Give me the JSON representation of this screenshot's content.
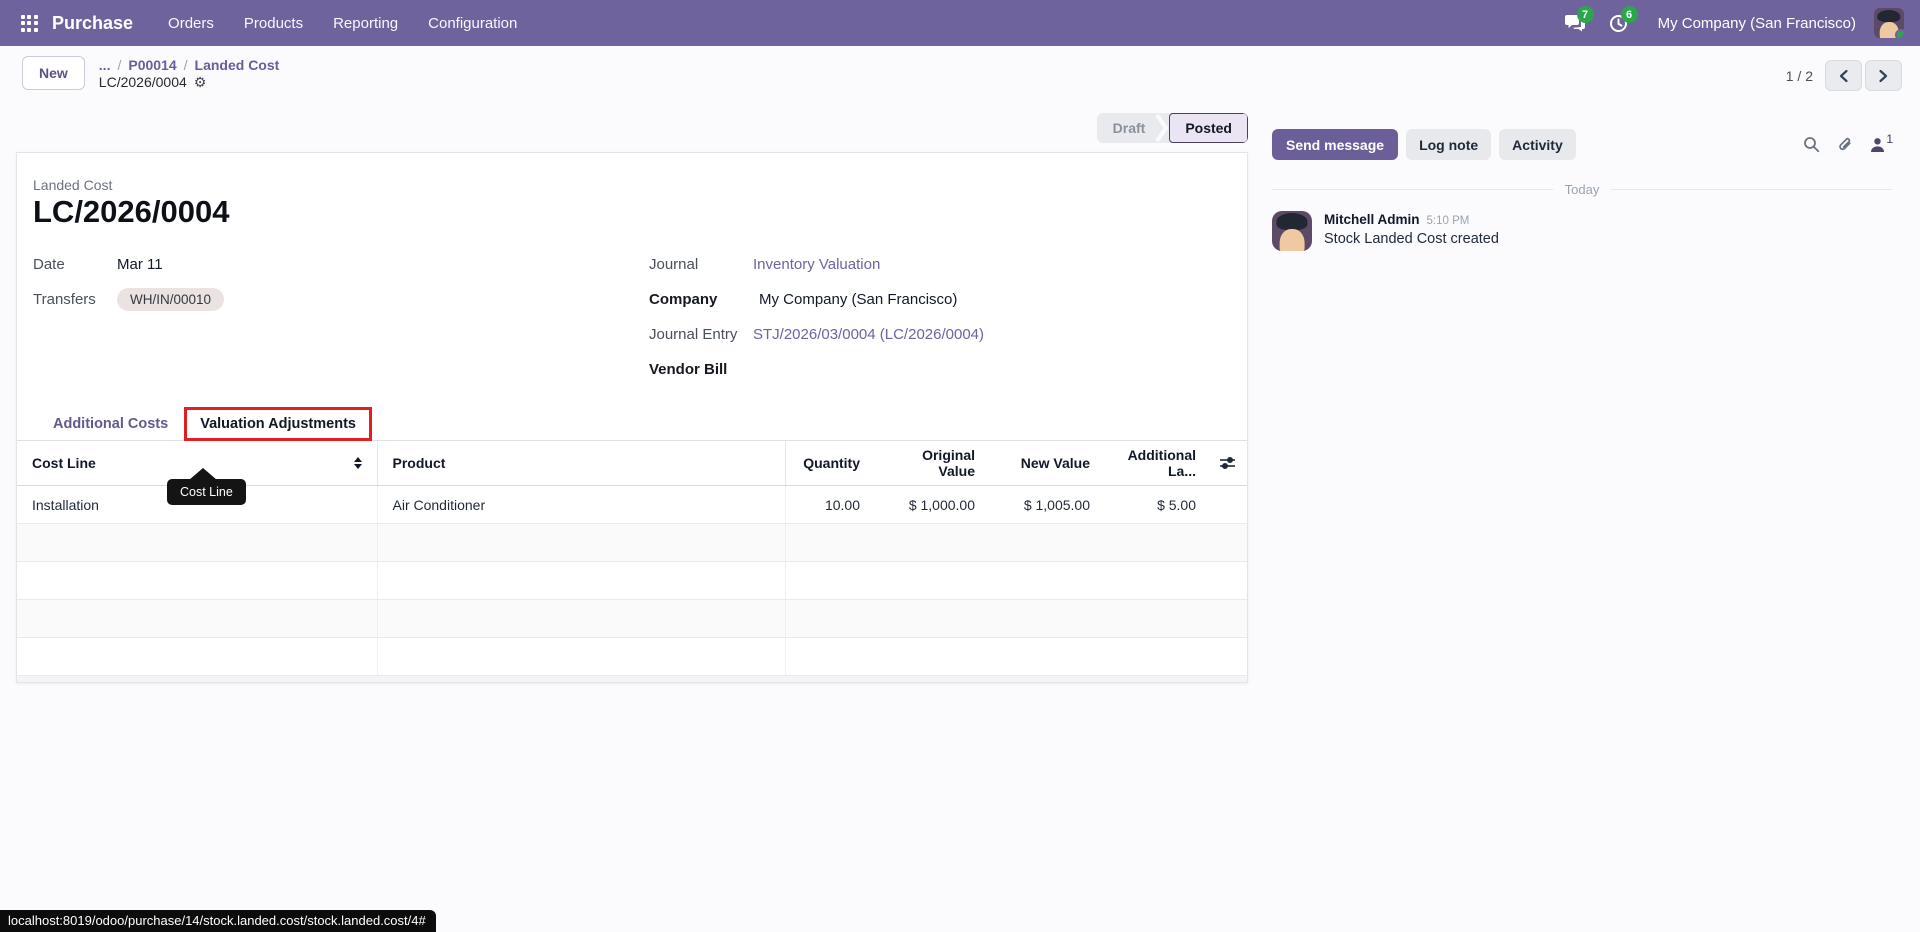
{
  "navbar": {
    "app_name": "Purchase",
    "menus": [
      "Orders",
      "Products",
      "Reporting",
      "Configuration"
    ],
    "messages_badge": "7",
    "activities_badge": "6",
    "company": "My Company (San Francisco)"
  },
  "control_panel": {
    "new_button": "New",
    "breadcrumb": {
      "ellipsis": "...",
      "separator": "/",
      "parent1": "P00014",
      "parent2": "Landed Cost",
      "current": "LC/2026/0004"
    },
    "pager": {
      "value": "1 / 2"
    }
  },
  "statusbar": {
    "draft": "Draft",
    "posted": "Posted"
  },
  "form": {
    "model_label": "Landed Cost",
    "title": "LC/2026/0004",
    "fields_left": [
      {
        "label": "Date",
        "value": "Mar 11"
      },
      {
        "label": "Transfers",
        "value": "WH/IN/00010"
      }
    ],
    "fields_right": [
      {
        "label": "Journal",
        "value": "Inventory Valuation"
      },
      {
        "label": "Company",
        "value": "My Company (San Francisco)"
      },
      {
        "label": "Journal Entry",
        "value": "STJ/2026/03/0004 (LC/2026/0004)"
      },
      {
        "label": "Vendor Bill",
        "value": ""
      }
    ],
    "tabs": [
      {
        "label": "Additional Costs"
      },
      {
        "label": "Valuation Adjustments"
      }
    ],
    "table": {
      "columns": [
        "Cost Line",
        "Product",
        "Quantity",
        "Original Value",
        "New Value",
        "Additional La..."
      ],
      "rows": [
        {
          "cost_line": "Installation",
          "product": "Air Conditioner",
          "quantity": "10.00",
          "original_value": "$ 1,000.00",
          "new_value": "$ 1,005.00",
          "additional": "$ 5.00"
        }
      ],
      "tooltip": "Cost Line"
    }
  },
  "chatter": {
    "send_message": "Send message",
    "log_note": "Log note",
    "activity": "Activity",
    "followers_count": "1",
    "date_divider": "Today",
    "message": {
      "author": "Mitchell Admin",
      "time": "5:10 PM",
      "body": "Stock Landed Cost created"
    }
  },
  "status_url": "localhost:8019/odoo/purchase/14/stock.landed.cost/stock.landed.cost/4#",
  "icons": {
    "apps": "grid-icon",
    "messages": "chat-bubble-icon",
    "activities": "clock-icon",
    "search": "magnifier-icon",
    "attachments": "paperclip-icon",
    "followers": "person-icon",
    "settings": "gear-icon",
    "sort": "sort-arrows-icon",
    "optional_columns": "sliders-icon",
    "prev": "chevron-left-icon",
    "next": "chevron-right-icon"
  },
  "colors": {
    "navbar": "#6e639c",
    "primary_button": "#6c5f99",
    "link": "#6f61a6",
    "badge_green": "#2ea44f",
    "highlight_red": "#e02020",
    "tooltip_bg": "#141414",
    "posted_bg": "#ebe5f3",
    "posted_border": "#4a3f63",
    "tag_bg": "#ebe3e1"
  }
}
